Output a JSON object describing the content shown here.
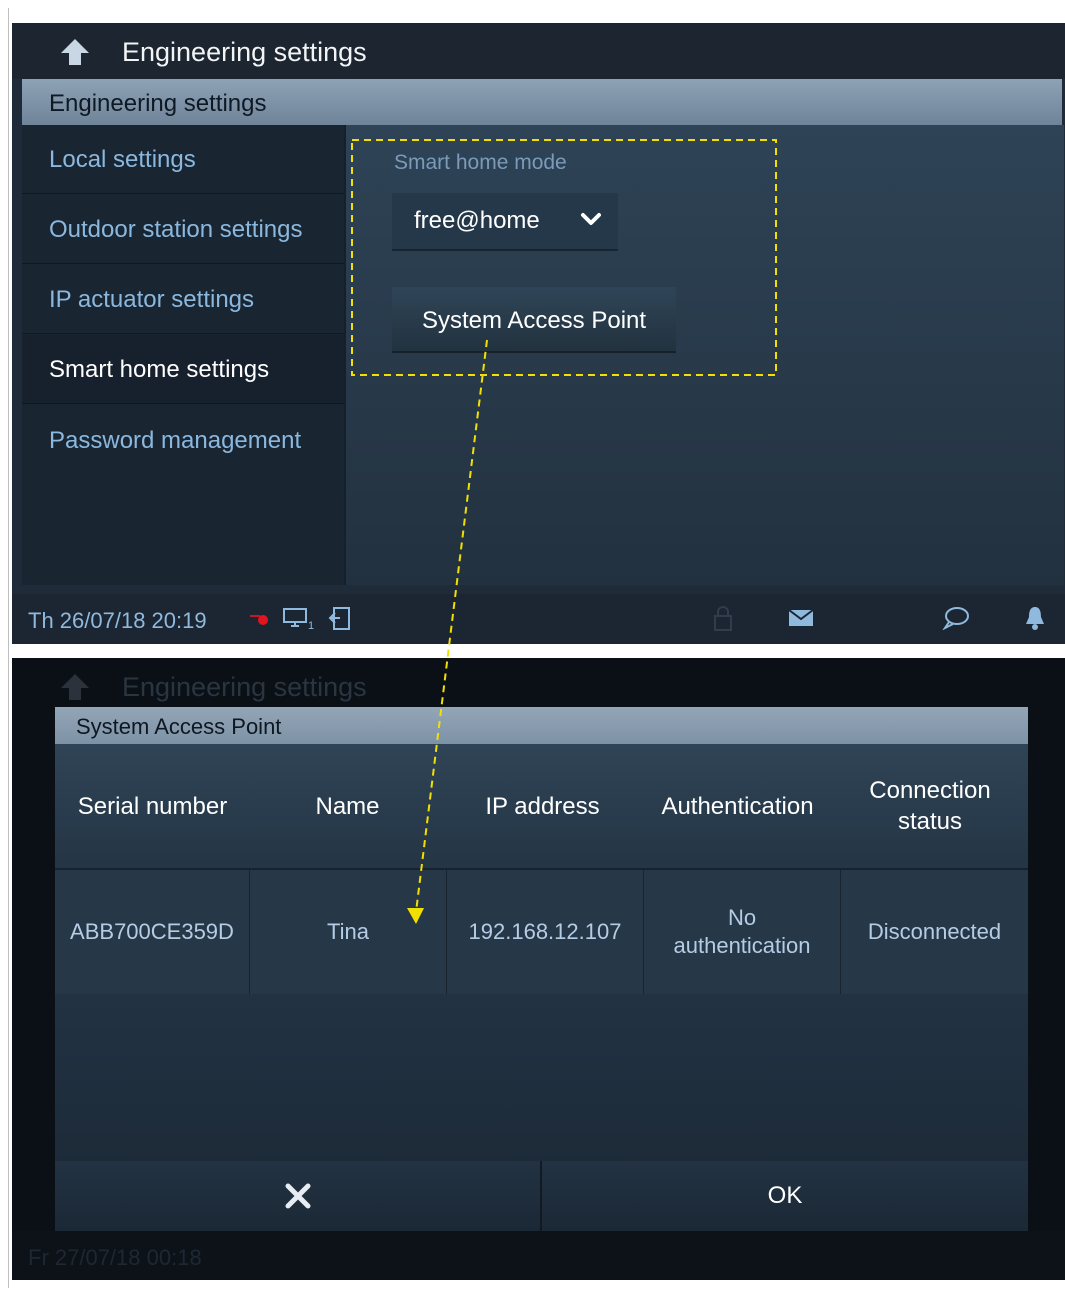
{
  "screen1": {
    "header_title": "Engineering settings",
    "section_title": "Engineering settings",
    "sidebar": {
      "items": [
        {
          "label": "Local settings"
        },
        {
          "label": "Outdoor station settings"
        },
        {
          "label": "IP actuator settings"
        },
        {
          "label": "Smart home settings",
          "active": true
        },
        {
          "label": "Password management"
        }
      ]
    },
    "content": {
      "mode_label": "Smart home mode",
      "mode_value": "free@home",
      "sap_button": "System Access Point"
    },
    "status_bar": {
      "datetime": "Th 26/07/18  20:19",
      "icons": [
        "red-dot-icon",
        "monitor-icon",
        "exit-icon",
        "lock-icon",
        "mail-icon",
        "chat-icon",
        "bell-icon"
      ]
    }
  },
  "screen2": {
    "header_title": "Engineering settings",
    "status_datetime": "Fr 27/07/18  00:18",
    "dialog": {
      "title": "System Access Point",
      "columns": [
        "Serial number",
        "Name",
        "IP address",
        "Authentication",
        "Connection status"
      ],
      "rows": [
        {
          "serial": "ABB700CE359D",
          "name": "Tina",
          "ip": "192.168.12.107",
          "auth": "No authentication",
          "status": "Disconnected"
        }
      ],
      "cancel_icon": "close-icon",
      "ok_label": "OK"
    }
  },
  "colors": {
    "accent_text": "#8ab8de",
    "annotation": "#f2e000"
  }
}
